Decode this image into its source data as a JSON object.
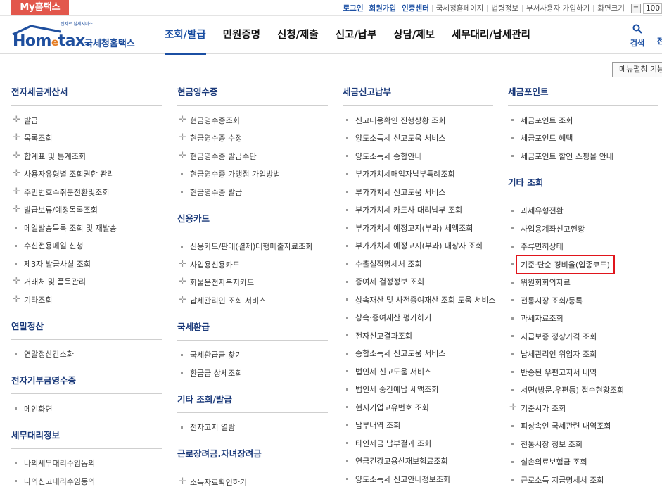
{
  "topbar": {
    "my_label": "My홈택스",
    "links_blue": [
      "로그인",
      "회원가입",
      "인증센터"
    ],
    "links": [
      "국세청홈페이지",
      "법령정보",
      "부서사용자 가입하기",
      "화면크기"
    ],
    "zoom_minus": "−",
    "zoom_value": "100"
  },
  "header": {
    "logo_sub": "전자로 납세서비스",
    "logo_home": "Hom",
    "logo_e": "e",
    "logo_tax": "tax.",
    "logo_kr": "국세청홈택스",
    "nav": [
      "조회/발급",
      "민원증명",
      "신청/제출",
      "신고/납부",
      "상담/제보",
      "세무대리/납세관리"
    ],
    "active_nav": 0,
    "search_label": "검색",
    "search2_label": "전"
  },
  "menu_toggle": "메뉴펼침 기능",
  "columns": [
    {
      "sections": [
        {
          "title": "전자세금계산서",
          "items": [
            {
              "label": "발급",
              "icon": "plus"
            },
            {
              "label": "목록조회",
              "icon": "plus"
            },
            {
              "label": "합계표 및 통계조회",
              "icon": "plus"
            },
            {
              "label": "사용자유형별 조회권한 관리",
              "icon": "plus"
            },
            {
              "label": "주민번호수취분전환및조회",
              "icon": "plus"
            },
            {
              "label": "발급보류/예정목록조회",
              "icon": "plus"
            },
            {
              "label": "메일발송목록 조회 및 재발송",
              "icon": "square"
            },
            {
              "label": "수신전용메일 신청",
              "icon": "square"
            },
            {
              "label": "제3자 발급사실 조회",
              "icon": "square"
            },
            {
              "label": "거래처 및 품목관리",
              "icon": "plus"
            },
            {
              "label": "기타조회",
              "icon": "plus"
            }
          ]
        },
        {
          "title": "연말정산",
          "items": [
            {
              "label": "연말정산간소화",
              "icon": "square"
            }
          ]
        },
        {
          "title": "전자기부금영수증",
          "items": [
            {
              "label": "메인화면",
              "icon": "square"
            }
          ]
        },
        {
          "title": "세무대리정보",
          "items": [
            {
              "label": "나의세무대리수임동의",
              "icon": "square"
            },
            {
              "label": "나의신고대리수임동의",
              "icon": "square"
            }
          ]
        }
      ]
    },
    {
      "sections": [
        {
          "title": "현금영수증",
          "items": [
            {
              "label": "현금영수증조회",
              "icon": "plus"
            },
            {
              "label": "현금영수증 수정",
              "icon": "plus"
            },
            {
              "label": "현금영수증 발급수단",
              "icon": "plus"
            },
            {
              "label": "현금영수증 가맹점 가입방법",
              "icon": "square"
            },
            {
              "label": "현금영수증 발급",
              "icon": "square"
            }
          ]
        },
        {
          "title": "신용카드",
          "items": [
            {
              "label": "신용카드/판매(결제)대행매출자료조회",
              "icon": "square"
            },
            {
              "label": "사업용신용카드",
              "icon": "plus"
            },
            {
              "label": "화물운전자복지카드",
              "icon": "plus"
            },
            {
              "label": "납세관리인 조회 서비스",
              "icon": "plus"
            }
          ]
        },
        {
          "title": "국세환급",
          "items": [
            {
              "label": "국세환급금 찾기",
              "icon": "square"
            },
            {
              "label": "환급금 상세조회",
              "icon": "square"
            }
          ]
        },
        {
          "title": "기타 조회/발급",
          "items": [
            {
              "label": "전자고지 열람",
              "icon": "square"
            }
          ]
        },
        {
          "title": "근로장려금.자녀장려금",
          "items": [
            {
              "label": "소득자료확인하기",
              "icon": "plus"
            }
          ]
        }
      ]
    },
    {
      "sections": [
        {
          "title": "세금신고납부",
          "items": [
            {
              "label": "신고내용확인 진행상황 조회",
              "icon": "square"
            },
            {
              "label": "양도소득세 신고도움 서비스",
              "icon": "square"
            },
            {
              "label": "양도소득세 종합안내",
              "icon": "square"
            },
            {
              "label": "부가가치세매입자납부특례조회",
              "icon": "square"
            },
            {
              "label": "부가가치세 신고도움 서비스",
              "icon": "square"
            },
            {
              "label": "부가가치세 카드사 대리납부 조회",
              "icon": "square"
            },
            {
              "label": "부가가치세 예정고지(부과) 세액조회",
              "icon": "square"
            },
            {
              "label": "부가가치세 예정고지(부과) 대상자 조회",
              "icon": "square"
            },
            {
              "label": "수출실적명세서 조회",
              "icon": "square"
            },
            {
              "label": "증여세 결정정보 조회",
              "icon": "square"
            },
            {
              "label": "상속재산 및 사전증여재산 조회 도움 서비스",
              "icon": "square"
            },
            {
              "label": "상속·증여재산 평가하기",
              "icon": "square"
            },
            {
              "label": "전자신고결과조회",
              "icon": "square"
            },
            {
              "label": "종합소득세 신고도움 서비스",
              "icon": "square"
            },
            {
              "label": "법인세 신고도움 서비스",
              "icon": "square"
            },
            {
              "label": "법인세 중간예납 세액조회",
              "icon": "square"
            },
            {
              "label": "현지기업고유번호 조회",
              "icon": "square"
            },
            {
              "label": "납부내역 조회",
              "icon": "square"
            },
            {
              "label": "타인세금 납부결과 조회",
              "icon": "square"
            },
            {
              "label": "연금건강고용산재보험료조회",
              "icon": "square"
            },
            {
              "label": "양도소득세 신고안내정보조회",
              "icon": "square"
            }
          ]
        }
      ]
    },
    {
      "sections": [
        {
          "title": "세금포인트",
          "items": [
            {
              "label": "세금포인트 조회",
              "icon": "square"
            },
            {
              "label": "세금포인트 혜택",
              "icon": "square"
            },
            {
              "label": "세금포인트 할인 쇼핑몰 안내",
              "icon": "square"
            }
          ]
        },
        {
          "title": "기타 조회",
          "items": [
            {
              "label": "과세유형전환",
              "icon": "square"
            },
            {
              "label": "사업용계좌신고현황",
              "icon": "square"
            },
            {
              "label": "주류면허상태",
              "icon": "square"
            },
            {
              "label": "기준·단순 경비율(업종코드)",
              "icon": "square",
              "highlighted": true
            },
            {
              "label": "위원회회의자료",
              "icon": "square"
            },
            {
              "label": "전통시장 조회/등록",
              "icon": "square"
            },
            {
              "label": "과세자료조회",
              "icon": "square"
            },
            {
              "label": "지급보증 정상가격 조회",
              "icon": "square"
            },
            {
              "label": "납세관리인 위임자 조회",
              "icon": "square"
            },
            {
              "label": "반송된 우편고지서 내역",
              "icon": "square"
            },
            {
              "label": "서면(방문,우편등) 접수현황조회",
              "icon": "square"
            },
            {
              "label": "기준시가 조회",
              "icon": "plus"
            },
            {
              "label": "피상속인 국세관련 내역조회",
              "icon": "square"
            },
            {
              "label": "전통시장 정보 조회",
              "icon": "square"
            },
            {
              "label": "실손의료보험금 조회",
              "icon": "square"
            },
            {
              "label": "근로소득 지급명세서 조회",
              "icon": "square"
            }
          ]
        }
      ]
    }
  ]
}
